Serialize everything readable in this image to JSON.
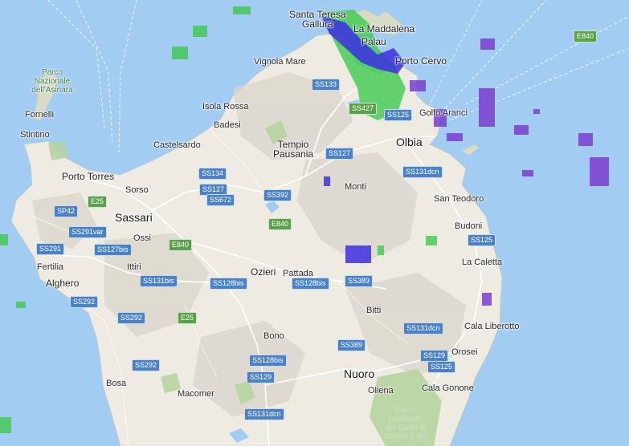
{
  "map": {
    "places": [
      {
        "id": "santa-teresa-gallura",
        "label": "Santa Teresa\nGallura",
        "kind": "city"
      },
      {
        "id": "la-maddalena",
        "label": "La Maddalena",
        "kind": "city"
      },
      {
        "id": "palau",
        "label": "Palau",
        "kind": "city"
      },
      {
        "id": "porto-cervo",
        "label": "Porto Cervo",
        "kind": "city"
      },
      {
        "id": "vignola-mare",
        "label": "Vignola Mare",
        "kind": "town"
      },
      {
        "id": "isola-rossa",
        "label": "Isola Rossa",
        "kind": "town"
      },
      {
        "id": "golfo-aranci",
        "label": "Golfo Aranci",
        "kind": "town"
      },
      {
        "id": "badesi",
        "label": "Badesi",
        "kind": "town"
      },
      {
        "id": "tempio-pausania",
        "label": "Tempio\nPausania",
        "kind": "city"
      },
      {
        "id": "olbia",
        "label": "Olbia",
        "kind": "city"
      },
      {
        "id": "castelsardo",
        "label": "Castelsardo",
        "kind": "town"
      },
      {
        "id": "fornelli",
        "label": "Fornelli",
        "kind": "town"
      },
      {
        "id": "stintino",
        "label": "Stintino",
        "kind": "town"
      },
      {
        "id": "porto-torres",
        "label": "Porto Torres",
        "kind": "city"
      },
      {
        "id": "sorso",
        "label": "Sorso",
        "kind": "town"
      },
      {
        "id": "sassari",
        "label": "Sassari",
        "kind": "big"
      },
      {
        "id": "ossi",
        "label": "Ossi",
        "kind": "town"
      },
      {
        "id": "monti",
        "label": "Monti",
        "kind": "town"
      },
      {
        "id": "san-teodoro",
        "label": "San Teodoro",
        "kind": "town"
      },
      {
        "id": "budoni",
        "label": "Budoni",
        "kind": "town"
      },
      {
        "id": "fertilia",
        "label": "Fertilia",
        "kind": "town"
      },
      {
        "id": "alghero",
        "label": "Alghero",
        "kind": "city"
      },
      {
        "id": "ittiri",
        "label": "Ittiri",
        "kind": "town"
      },
      {
        "id": "ozieri",
        "label": "Ozieri",
        "kind": "city"
      },
      {
        "id": "pattada",
        "label": "Pattada",
        "kind": "town"
      },
      {
        "id": "la-caletta",
        "label": "La Caletta",
        "kind": "town"
      },
      {
        "id": "bitti",
        "label": "Bitti",
        "kind": "town"
      },
      {
        "id": "cala-liberotto",
        "label": "Cala Liberotto",
        "kind": "town"
      },
      {
        "id": "bono",
        "label": "Bono",
        "kind": "town"
      },
      {
        "id": "orosei",
        "label": "Orosei",
        "kind": "town"
      },
      {
        "id": "nuoro",
        "label": "Nuoro",
        "kind": "big"
      },
      {
        "id": "bosa",
        "label": "Bosa",
        "kind": "town"
      },
      {
        "id": "macomer",
        "label": "Macomer",
        "kind": "town"
      },
      {
        "id": "oliena",
        "label": "Oliena",
        "kind": "town"
      },
      {
        "id": "cala-gonone",
        "label": "Cala Gonone",
        "kind": "town"
      },
      {
        "id": "parco-asinara",
        "label": "Parco\nNazionale\ndell'Asinara",
        "kind": "park"
      },
      {
        "id": "parco-orosei",
        "label": "Parco\nnazionale\ndel Golfo di\nOrosei e del",
        "kind": "park-dark"
      }
    ],
    "road_shields": [
      {
        "label": "E840",
        "type": "e"
      },
      {
        "label": "SS133",
        "type": "ss"
      },
      {
        "label": "SS427",
        "type": "e"
      },
      {
        "label": "SS125",
        "type": "ss"
      },
      {
        "label": "SS127",
        "type": "ss"
      },
      {
        "label": "SS134",
        "type": "ss"
      },
      {
        "label": "SS131dcn",
        "type": "ss"
      },
      {
        "label": "SS127",
        "type": "ss"
      },
      {
        "label": "SS672",
        "type": "ss"
      },
      {
        "label": "SS392",
        "type": "ss"
      },
      {
        "label": "E25",
        "type": "e"
      },
      {
        "label": "SP42",
        "type": "ss"
      },
      {
        "label": "E840",
        "type": "e"
      },
      {
        "label": "SS291var",
        "type": "ss"
      },
      {
        "label": "SS291",
        "type": "ss"
      },
      {
        "label": "SS127bis",
        "type": "ss"
      },
      {
        "label": "E840",
        "type": "e"
      },
      {
        "label": "SS125",
        "type": "ss"
      },
      {
        "label": "SS131bis",
        "type": "ss"
      },
      {
        "label": "SS128bis",
        "type": "ss"
      },
      {
        "label": "SS128bis",
        "type": "ss"
      },
      {
        "label": "SS389",
        "type": "ss"
      },
      {
        "label": "SS292",
        "type": "ss"
      },
      {
        "label": "SS292",
        "type": "ss"
      },
      {
        "label": "E25",
        "type": "e"
      },
      {
        "label": "SS131dcn",
        "type": "ss"
      },
      {
        "label": "SS389",
        "type": "ss"
      },
      {
        "label": "SS129",
        "type": "ss"
      },
      {
        "label": "SS128bis",
        "type": "ss"
      },
      {
        "label": "SS125",
        "type": "ss"
      },
      {
        "label": "SS292",
        "type": "ss"
      },
      {
        "label": "SS129",
        "type": "ss"
      },
      {
        "label": "SS131dcn",
        "type": "ss"
      }
    ],
    "colors": {
      "sea": "#a3ccf3",
      "land": "#eeebe3",
      "relief": "#cfcbc1",
      "forest": "#b4d29e",
      "road": "#ffffff",
      "road_shield_ss": "#4b82c6",
      "road_shield_e": "#5aa24a",
      "radar_green": "#3fc94f",
      "radar_blue": "#3d2fe0",
      "radar_purple": "#7a3fd0"
    }
  }
}
